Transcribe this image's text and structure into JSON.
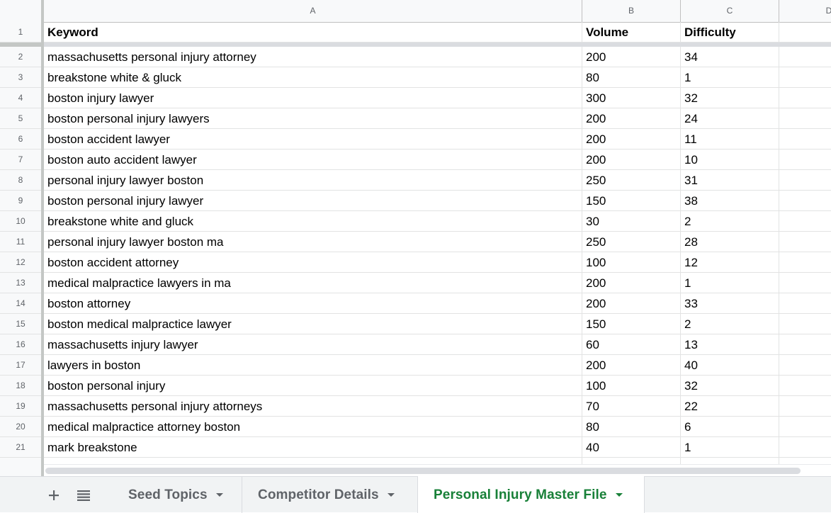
{
  "columns": [
    {
      "letter": "A"
    },
    {
      "letter": "B"
    },
    {
      "letter": "C"
    },
    {
      "letter": "D"
    }
  ],
  "header_row": {
    "number": "1",
    "keyword": "Keyword",
    "volume": "Volume",
    "difficulty": "Difficulty"
  },
  "rows": [
    {
      "number": "2",
      "keyword": "massachusetts personal injury attorney",
      "volume": "200",
      "difficulty": "34"
    },
    {
      "number": "3",
      "keyword": "breakstone white & gluck",
      "volume": "80",
      "difficulty": "1"
    },
    {
      "number": "4",
      "keyword": "boston injury lawyer",
      "volume": "300",
      "difficulty": "32"
    },
    {
      "number": "5",
      "keyword": "boston personal injury lawyers",
      "volume": "200",
      "difficulty": "24"
    },
    {
      "number": "6",
      "keyword": "boston accident lawyer",
      "volume": "200",
      "difficulty": "11"
    },
    {
      "number": "7",
      "keyword": "boston auto accident lawyer",
      "volume": "200",
      "difficulty": "10"
    },
    {
      "number": "8",
      "keyword": "personal injury lawyer boston",
      "volume": "250",
      "difficulty": "31"
    },
    {
      "number": "9",
      "keyword": "boston personal injury lawyer",
      "volume": "150",
      "difficulty": "38"
    },
    {
      "number": "10",
      "keyword": "breakstone white and gluck",
      "volume": "30",
      "difficulty": "2"
    },
    {
      "number": "11",
      "keyword": "personal injury lawyer boston ma",
      "volume": "250",
      "difficulty": "28"
    },
    {
      "number": "12",
      "keyword": "boston accident attorney",
      "volume": "100",
      "difficulty": "12"
    },
    {
      "number": "13",
      "keyword": "medical malpractice lawyers in ma",
      "volume": "200",
      "difficulty": "1"
    },
    {
      "number": "14",
      "keyword": "boston attorney",
      "volume": "200",
      "difficulty": "33"
    },
    {
      "number": "15",
      "keyword": "boston medical malpractice lawyer",
      "volume": "150",
      "difficulty": "2"
    },
    {
      "number": "16",
      "keyword": "massachusetts injury lawyer",
      "volume": "60",
      "difficulty": "13"
    },
    {
      "number": "17",
      "keyword": "lawyers in boston",
      "volume": "200",
      "difficulty": "40"
    },
    {
      "number": "18",
      "keyword": "boston personal injury",
      "volume": "100",
      "difficulty": "32"
    },
    {
      "number": "19",
      "keyword": "massachusetts personal injury attorneys",
      "volume": "70",
      "difficulty": "22"
    },
    {
      "number": "20",
      "keyword": "medical malpractice attorney boston",
      "volume": "80",
      "difficulty": "6"
    },
    {
      "number": "21",
      "keyword": "mark breakstone",
      "volume": "40",
      "difficulty": "1"
    }
  ],
  "tabs": [
    {
      "label": "Seed Topics",
      "active": false
    },
    {
      "label": "Competitor Details",
      "active": false
    },
    {
      "label": "Personal Injury Master File",
      "active": true
    }
  ],
  "icons": {
    "add_sheet": "plus-icon",
    "all_sheets": "list-icon",
    "tab_menu": "caret-down-icon"
  },
  "colors": {
    "active_tab_text": "#188038",
    "header_bg": "#f8f9fa",
    "gridline": "#e2e3e3",
    "freeze_bar": "#c4c7c5"
  }
}
